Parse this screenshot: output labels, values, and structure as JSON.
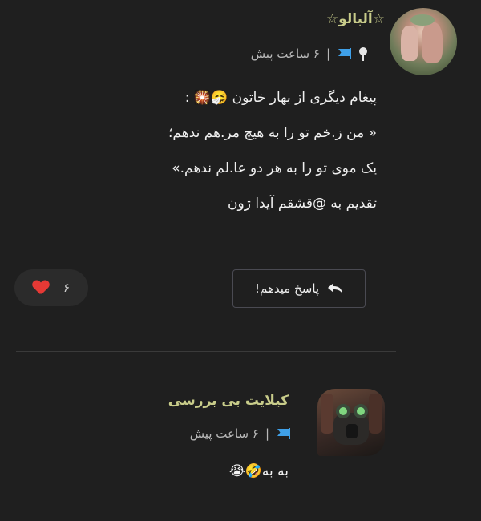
{
  "comments": [
    {
      "author": "☆آلبالو☆",
      "time": "۶ ساعت پیش",
      "separator": "|",
      "lines": [
        "پیغام دیگری از بهار خاتون 🤧🎇 :",
        "« من ز.خم تو را به هیچ مر.هم ندهم؛",
        "یک موی تو را به هر دو عا.لم ندهم.»",
        "تقدیم به @قشقم آیدا ژون"
      ],
      "likes": "۶",
      "reply_label": "پاسخ میدهم!"
    },
    {
      "author": "کیلایت بی بررسی",
      "time": "۶ ساعت پیش",
      "separator": "|",
      "text": "به به🤣😭"
    }
  ],
  "colors": {
    "background": "#1f1f1f",
    "author": "#c8cc8a",
    "flag": "#3fa0e8",
    "heart": "#e53935"
  },
  "icons": [
    "pin-icon",
    "flag-icon",
    "heart-icon",
    "reply-arrow-icon"
  ]
}
